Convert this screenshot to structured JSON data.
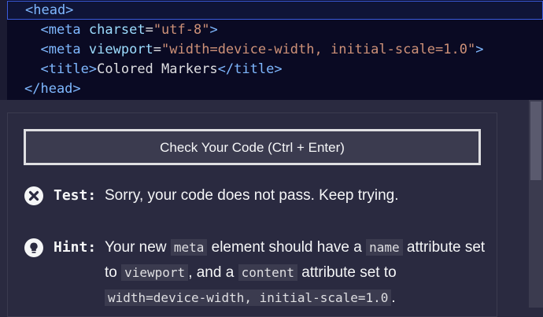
{
  "editor": {
    "lines": [
      {
        "indent": "",
        "parts": [
          [
            "tag",
            "<head>"
          ]
        ]
      },
      {
        "indent": "  ",
        "parts": [
          [
            "tag",
            "<meta "
          ],
          [
            "attr",
            "charset"
          ],
          [
            "txt",
            "="
          ],
          [
            "str",
            "\"utf-8\""
          ],
          [
            "tag",
            ">"
          ]
        ]
      },
      {
        "indent": "  ",
        "parts": [
          [
            "tag",
            "<meta "
          ],
          [
            "attr",
            "viewport"
          ],
          [
            "txt",
            "="
          ],
          [
            "str",
            "\"width=device-width, initial-scale=1.0\""
          ],
          [
            "tag",
            ">"
          ]
        ]
      },
      {
        "indent": "  ",
        "parts": [
          [
            "tag",
            "<title>"
          ],
          [
            "txt",
            "Colored Markers"
          ],
          [
            "tag",
            "</title>"
          ]
        ]
      },
      {
        "indent": "",
        "parts": [
          [
            "tag",
            "</head>"
          ]
        ]
      }
    ]
  },
  "panel": {
    "check_button": "Check Your Code (Ctrl + Enter)",
    "test": {
      "label": "Test:",
      "message": "Sorry, your code does not pass. Keep trying.",
      "icon": "close-circle-icon"
    },
    "hint": {
      "label": "Hint:",
      "icon": "lightbulb-icon",
      "segments": [
        {
          "t": "text",
          "v": "Your new "
        },
        {
          "t": "code",
          "v": "meta"
        },
        {
          "t": "text",
          "v": " element should have a "
        },
        {
          "t": "code",
          "v": "name"
        },
        {
          "t": "text",
          "v": " attribute set to "
        },
        {
          "t": "code",
          "v": "viewport"
        },
        {
          "t": "text",
          "v": ", and a "
        },
        {
          "t": "code",
          "v": "content"
        },
        {
          "t": "text",
          "v": " attribute set to "
        },
        {
          "t": "code",
          "v": "width=device-width, initial-scale=1.0"
        },
        {
          "t": "text",
          "v": "."
        }
      ]
    }
  },
  "colors": {
    "editor_bg": "#0a0a23",
    "panel_bg": "#2a2a40",
    "tag": "#7fb8ff",
    "attr": "#9cdcfe",
    "string": "#ce9178",
    "active_line_border": "#3b5bdb"
  }
}
